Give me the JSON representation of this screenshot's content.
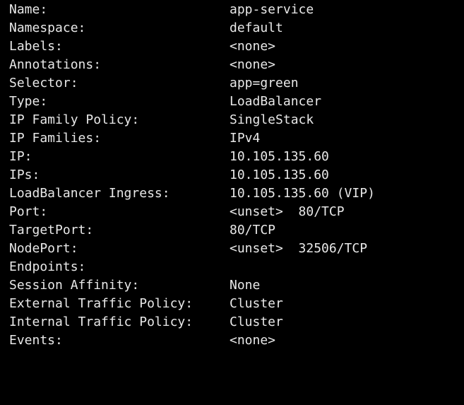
{
  "terminal": {
    "rows": [
      {
        "key": "Name:",
        "value": "app-service"
      },
      {
        "key": "Namespace:",
        "value": "default"
      },
      {
        "key": "Labels:",
        "value": "<none>"
      },
      {
        "key": "Annotations:",
        "value": "<none>"
      },
      {
        "key": "Selector:",
        "value": "app=green"
      },
      {
        "key": "Type:",
        "value": "LoadBalancer"
      },
      {
        "key": "IP Family Policy:",
        "value": "SingleStack"
      },
      {
        "key": "IP Families:",
        "value": "IPv4"
      },
      {
        "key": "IP:",
        "value": "10.105.135.60"
      },
      {
        "key": "IPs:",
        "value": "10.105.135.60"
      },
      {
        "key": "LoadBalancer Ingress:",
        "value": "10.105.135.60 (VIP)"
      },
      {
        "key": "Port:",
        "value": "<unset>  80/TCP"
      },
      {
        "key": "TargetPort:",
        "value": "80/TCP"
      },
      {
        "key": "NodePort:",
        "value": "<unset>  32506/TCP"
      },
      {
        "key": "Endpoints:",
        "value": ""
      },
      {
        "key": "Session Affinity:",
        "value": "None"
      },
      {
        "key": "External Traffic Policy:",
        "value": "Cluster"
      },
      {
        "key": "Internal Traffic Policy:",
        "value": "Cluster"
      },
      {
        "key": "Events:",
        "value": "<none>"
      }
    ]
  }
}
